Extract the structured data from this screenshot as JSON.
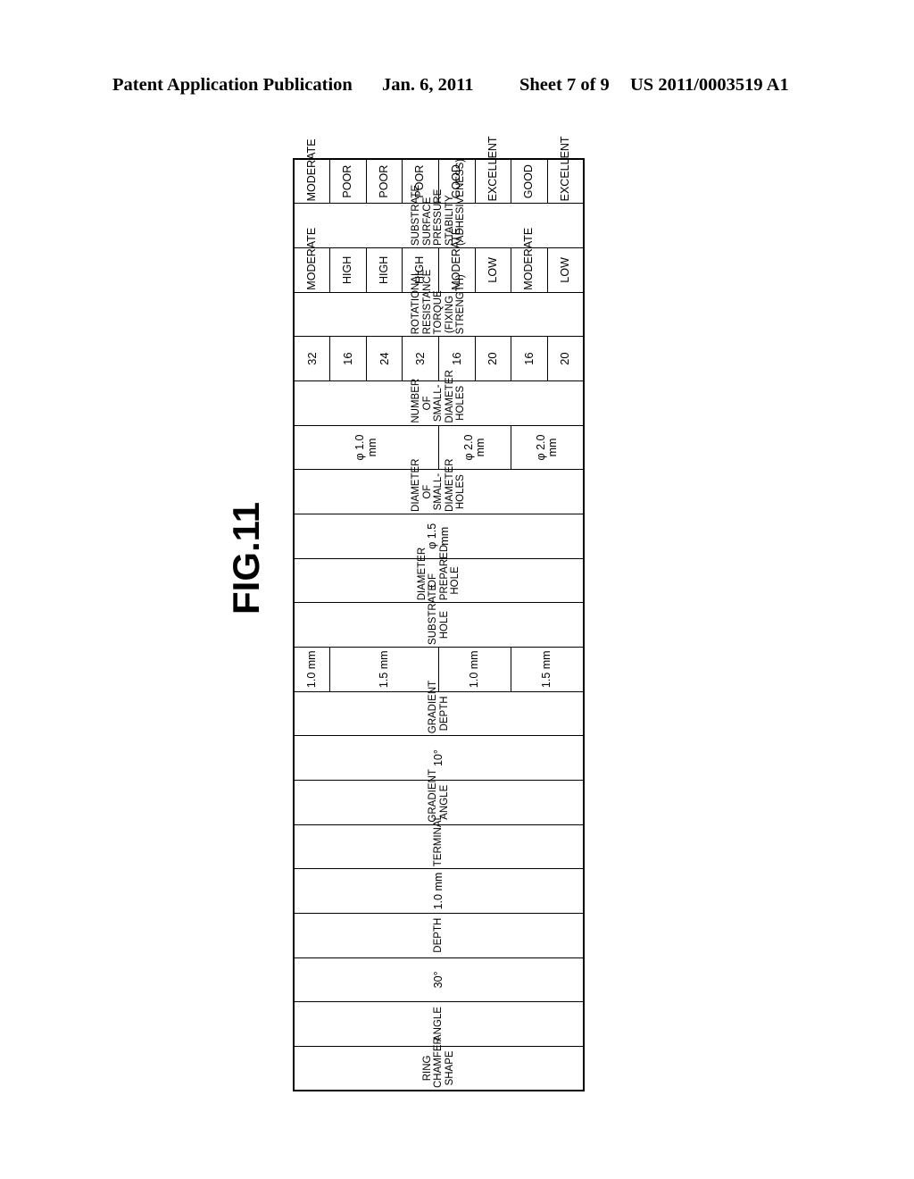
{
  "page_header": {
    "publication": "Patent Application Publication",
    "date": "Jan. 6, 2011",
    "sheet": "Sheet 7 of 9",
    "patent_number": "US 2011/0003519 A1"
  },
  "figure": {
    "label": "FIG.11"
  },
  "table": {
    "group_headers": {
      "ring_chamfer_shape": "RING CHAMFER\nSHAPE",
      "terminal": "TERMINAL",
      "substrate_hole": "SUBSTRATE HOLE"
    },
    "column_headers": {
      "angle": "ANGLE",
      "depth": "DEPTH",
      "gradient_angle": "GRADIENT\nANGLE",
      "gradient_depth": "GRADIENT\nDEPTH",
      "diameter_of_prepared_hole": "DIAMETER OF\nPREPARED\nHOLE",
      "diameter_of_small_diameter_holes": "DIAMETER OF\nSMALL-DIAMETER\nHOLES",
      "number_of_small_diameter_holes": "NUMBER OF\nSMALL-DIAMETER\nHOLES",
      "rotational_resistance_torque": "ROTATIONAL\nRESISTANCE\nTORQUE\n(FIXING\nSTRENGTH)",
      "substrate_surface_pressure_stability": "SUBSTRATE\nSURFACE\nPRESSURE\nSTABILITY\n(ADHESIVENESS)"
    },
    "merged_values": {
      "angle": "30°",
      "depth": "1.0 mm",
      "gradient_angle": "10°",
      "diameter_of_prepared_hole": "φ 1.5 mm"
    },
    "gradient_depth_groups": [
      {
        "value": "1.0 mm",
        "rowspan": 1
      },
      {
        "value": "1.5 mm",
        "rowspan": 3
      },
      {
        "value": "1.0 mm",
        "rowspan": 2
      },
      {
        "value": "1.5 mm",
        "rowspan": 2
      }
    ],
    "small_hole_diameter_groups": [
      {
        "value": "φ 1.0 mm",
        "rowspan": 4
      },
      {
        "value": "φ 2.0 mm",
        "rowspan": 2
      },
      {
        "value": "φ 2.0 mm",
        "rowspan": 2
      }
    ],
    "rows": [
      {
        "number_of_holes": "32",
        "torque": "MODERATE",
        "stability": "MODERATE"
      },
      {
        "number_of_holes": "16",
        "torque": "HIGH",
        "stability": "POOR"
      },
      {
        "number_of_holes": "24",
        "torque": "HIGH",
        "stability": "POOR"
      },
      {
        "number_of_holes": "32",
        "torque": "HIGH",
        "stability": "POOR"
      },
      {
        "number_of_holes": "16",
        "torque": "MODERATE",
        "stability": "GOOD"
      },
      {
        "number_of_holes": "20",
        "torque": "LOW",
        "stability": "EXCELLENT"
      },
      {
        "number_of_holes": "16",
        "torque": "MODERATE",
        "stability": "GOOD"
      },
      {
        "number_of_holes": "20",
        "torque": "LOW",
        "stability": "EXCELLENT"
      }
    ]
  }
}
